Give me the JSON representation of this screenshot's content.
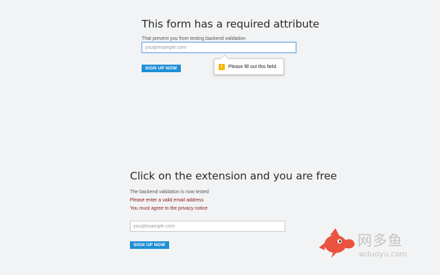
{
  "top_form": {
    "title": "This form has a required attribute",
    "note": "That prevent you from testing backend validation",
    "email_placeholder": "you@example.com",
    "button_label": "SIGN UP NOW",
    "validation_tooltip": {
      "icon": "warning-icon",
      "icon_glyph": "!",
      "message": "Please fill out this field."
    }
  },
  "bottom_form": {
    "title": "Click on the extension and you are free",
    "note": "The backend validation is now tested",
    "errors": [
      "Please enter a valid email address",
      "You must agree to the privacy notice"
    ],
    "email_placeholder": "you@example.com",
    "button_label": "SIGN UP NOW"
  },
  "watermark": {
    "logo": "fish-logo-icon",
    "text": "网多鱼",
    "url": "wduoyu.com"
  },
  "colors": {
    "background": "#f2f3f4",
    "button": "#1e8ed6",
    "error_text": "#8b1a1a",
    "warning_icon": "#f4b400",
    "focus_border": "#7aa7e0",
    "logo_red": "#e9533f"
  }
}
